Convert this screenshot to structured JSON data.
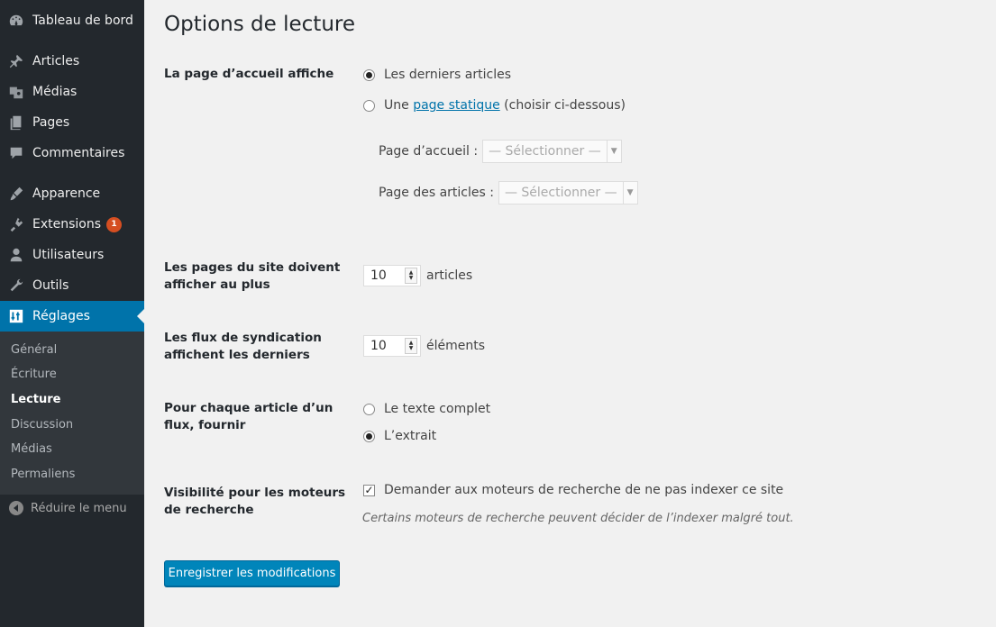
{
  "sidebar": {
    "items": [
      {
        "label": "Tableau de bord",
        "icon": "dashboard-icon"
      },
      {
        "label": "Articles",
        "icon": "pin-icon"
      },
      {
        "label": "Médias",
        "icon": "media-icon"
      },
      {
        "label": "Pages",
        "icon": "pages-icon"
      },
      {
        "label": "Commentaires",
        "icon": "comment-icon"
      },
      {
        "label": "Apparence",
        "icon": "brush-icon"
      },
      {
        "label": "Extensions",
        "icon": "plugin-icon",
        "badge": "1"
      },
      {
        "label": "Utilisateurs",
        "icon": "user-icon"
      },
      {
        "label": "Outils",
        "icon": "wrench-icon"
      },
      {
        "label": "Réglages",
        "icon": "settings-icon"
      }
    ],
    "submenu": [
      "Général",
      "Écriture",
      "Lecture",
      "Discussion",
      "Médias",
      "Permaliens"
    ],
    "collapse_label": "Réduire le menu"
  },
  "main": {
    "title": "Options de lecture",
    "front_page": {
      "label": "La page d’accueil affiche",
      "option_latest": "Les derniers articles",
      "option_static_prefix": "Une",
      "option_static_link": "page statique",
      "option_static_suffix": "(choisir ci-dessous)",
      "homepage_label": "Page d’accueil :",
      "posts_page_label": "Page des articles :",
      "select_placeholder": "— Sélectionner —"
    },
    "posts_per_page": {
      "label": "Les pages du site doivent afficher au plus",
      "value": "10",
      "unit": "articles"
    },
    "feed_items": {
      "label": "Les flux de syndication affichent les derniers",
      "value": "10",
      "unit": "éléments"
    },
    "feed_content": {
      "label": "Pour chaque article d’un flux, fournir",
      "option_full": "Le texte complet",
      "option_excerpt": "L’extrait"
    },
    "visibility": {
      "label": "Visibilité pour les moteurs de recherche",
      "checkbox_label": "Demander aux moteurs de recherche de ne pas indexer ce site",
      "description": "Certains moteurs de recherche peuvent décider de l’indexer malgré tout."
    },
    "save_label": "Enregistrer les modifications"
  },
  "colors": {
    "sidebar": "#23282d",
    "accent": "#0073aa",
    "button": "#0085ba",
    "badge": "#d54e21"
  }
}
